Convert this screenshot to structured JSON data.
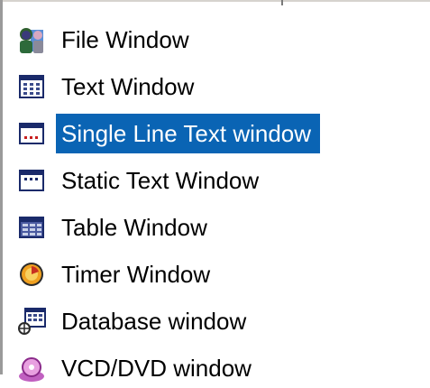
{
  "menu": {
    "items": [
      {
        "label": "File Window",
        "icon": "file-window-icon",
        "selected": false
      },
      {
        "label": "Text Window",
        "icon": "text-window-icon",
        "selected": false
      },
      {
        "label": "Single Line Text window",
        "icon": "single-line-text-window-icon",
        "selected": true
      },
      {
        "label": "Static Text Window",
        "icon": "static-text-window-icon",
        "selected": false
      },
      {
        "label": "Table Window",
        "icon": "table-window-icon",
        "selected": false
      },
      {
        "label": "Timer Window",
        "icon": "timer-window-icon",
        "selected": false
      },
      {
        "label": "Database window",
        "icon": "database-window-icon",
        "selected": false
      },
      {
        "label": "VCD/DVD window",
        "icon": "vcd-dvd-window-icon",
        "selected": false
      }
    ],
    "colors": {
      "selection_bg": "#0a64b4",
      "selection_text": "#ffffff",
      "text": "#000000"
    }
  }
}
